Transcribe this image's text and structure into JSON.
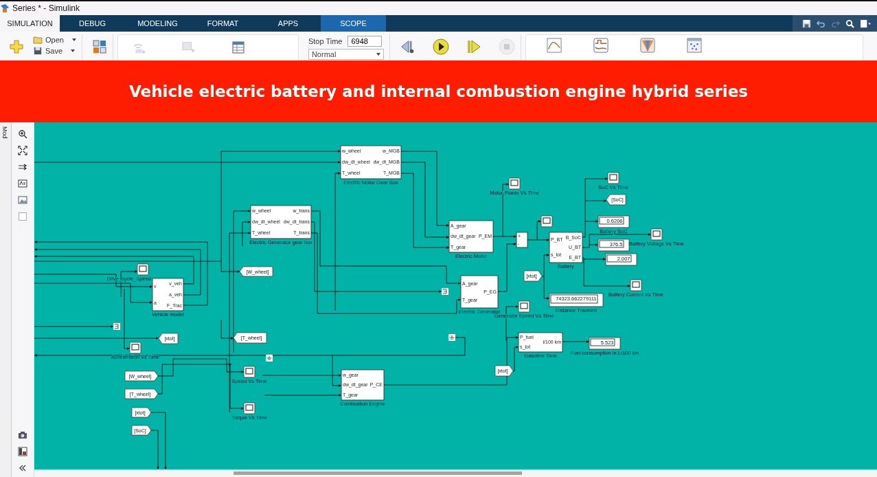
{
  "window": {
    "title": "Series * - Simulink"
  },
  "tabs": [
    {
      "label": "SIMULATION",
      "selected": true,
      "contextual": false
    },
    {
      "label": "DEBUG",
      "selected": false,
      "contextual": false
    },
    {
      "label": "MODELING",
      "selected": false,
      "contextual": false
    },
    {
      "label": "FORMAT",
      "selected": false,
      "contextual": false
    },
    {
      "label": "APPS",
      "selected": false,
      "contextual": false
    },
    {
      "label": "SCOPE",
      "selected": false,
      "contextual": true
    }
  ],
  "toolstrip": {
    "file": [
      {
        "label": "Open"
      },
      {
        "label": "Save"
      }
    ],
    "stop_time": {
      "label": "Stop Time",
      "value": "6948"
    },
    "mode": {
      "value": "Normal"
    }
  },
  "banner": {
    "title": "Vehicle electric battery and internal combustion engine hybrid series"
  },
  "side_panel": {
    "label": "Mod"
  },
  "diagram": {
    "blocks": [
      {
        "kind": "subsystem",
        "name": "Electric Motor Gear Box",
        "inputs": [
          "w_wheel",
          "dw_dt_wheel",
          "T_wheel"
        ],
        "outputs": [
          "w_MGB",
          "dw_dt_MGB",
          "T_MGB"
        ]
      },
      {
        "kind": "scope",
        "label": "SoC Vs Time"
      },
      {
        "kind": "scope",
        "label": "Motor Power Vs Time"
      },
      {
        "kind": "goto",
        "text": "[SoC]"
      },
      {
        "kind": "subsystem",
        "name": "Electric Generator gear box",
        "inputs": [
          "w_wheel",
          "dw_dt_wheel",
          "T_wheel"
        ],
        "outputs": [
          "w_trans",
          "dw_dt_trans",
          "T_trans"
        ]
      },
      {
        "kind": "subsystem",
        "name": "Electric Motor",
        "inputs": [
          "A_gear",
          "dw_dt_gear",
          "T_gear"
        ],
        "outputs": [
          "P_EM"
        ]
      },
      {
        "kind": "scope"
      },
      {
        "kind": "display",
        "value": "0.6206",
        "label": "Battery SoC"
      },
      {
        "kind": "sum",
        "inputs": [
          "+",
          "-"
        ]
      },
      {
        "kind": "subsystem",
        "name": "Battery",
        "inputs": [
          "P_BT",
          "s_tot"
        ],
        "outputs": [
          "B_SoC",
          "U_BT",
          "E_BT"
        ]
      },
      {
        "kind": "display",
        "value": "376.5"
      },
      {
        "kind": "scope",
        "label": "Battery Voltage Vs Time"
      },
      {
        "kind": "display",
        "value": "2.007"
      },
      {
        "kind": "scope",
        "label": "Drive_cycle_Speed"
      },
      {
        "kind": "goto",
        "text": "[W_wheel]"
      },
      {
        "kind": "from",
        "text": "[xtot]"
      },
      {
        "kind": "subsystem",
        "name": "Vehicle model",
        "inputs": [
          "v",
          "a"
        ],
        "outputs": [
          "v_veh",
          "a_veh",
          "F_Trac"
        ]
      },
      {
        "kind": "subsystem",
        "name": "Electric Generator",
        "inputs": [
          "A_gear",
          "T_gear"
        ],
        "outputs": [
          "P_EG"
        ]
      },
      {
        "kind": "scope",
        "label": "Battery Current Vs Time"
      },
      {
        "kind": "terminator"
      },
      {
        "kind": "display",
        "value": "74323.662279111",
        "label": "Distance Traveled"
      },
      {
        "kind": "scope",
        "label": "Generator Speed Vs Time"
      },
      {
        "kind": "terminator"
      },
      {
        "kind": "goto",
        "text": "[xtot]"
      },
      {
        "kind": "goto",
        "text": "[T_wheel]"
      },
      {
        "kind": "ground"
      },
      {
        "kind": "subsystem",
        "name": "Gasoline Tank",
        "inputs": [
          "P_fuel",
          "s_tot"
        ],
        "outputs": [
          "l/100 km"
        ]
      },
      {
        "kind": "display",
        "value": "5.523",
        "label": "Fuel consumption in L/100 km"
      },
      {
        "kind": "scope",
        "label": "Acceleration Vs Time"
      },
      {
        "kind": "ground"
      },
      {
        "kind": "from",
        "text": "[W_wheel]"
      },
      {
        "kind": "scope",
        "label": "Speed Vs Time"
      },
      {
        "kind": "subsystem",
        "name": "Combustion Engine",
        "inputs": [
          "w_gear",
          "dw_dt_gear",
          "T_gear"
        ],
        "outputs": [
          "P_CE"
        ]
      },
      {
        "kind": "from",
        "text": "[xtot]"
      },
      {
        "kind": "from",
        "text": "[T_wheel]"
      },
      {
        "kind": "from",
        "text": "[xtot]"
      },
      {
        "kind": "scope",
        "label": "Torque Vs Time"
      },
      {
        "kind": "from",
        "text": "[SoC]"
      }
    ]
  }
}
